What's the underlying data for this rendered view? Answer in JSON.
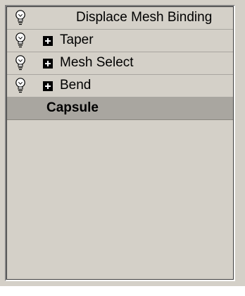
{
  "modifier_stack": {
    "items": [
      {
        "label": "Displace Mesh Binding",
        "icon": "lightbulb-icon",
        "expandable": false
      },
      {
        "label": "Taper",
        "icon": "lightbulb-icon",
        "expandable": true
      },
      {
        "label": "Mesh Select",
        "icon": "lightbulb-icon",
        "expandable": true
      },
      {
        "label": "Bend",
        "icon": "lightbulb-icon",
        "expandable": true
      }
    ],
    "base_object": {
      "label": "Capsule",
      "selected": true
    }
  }
}
